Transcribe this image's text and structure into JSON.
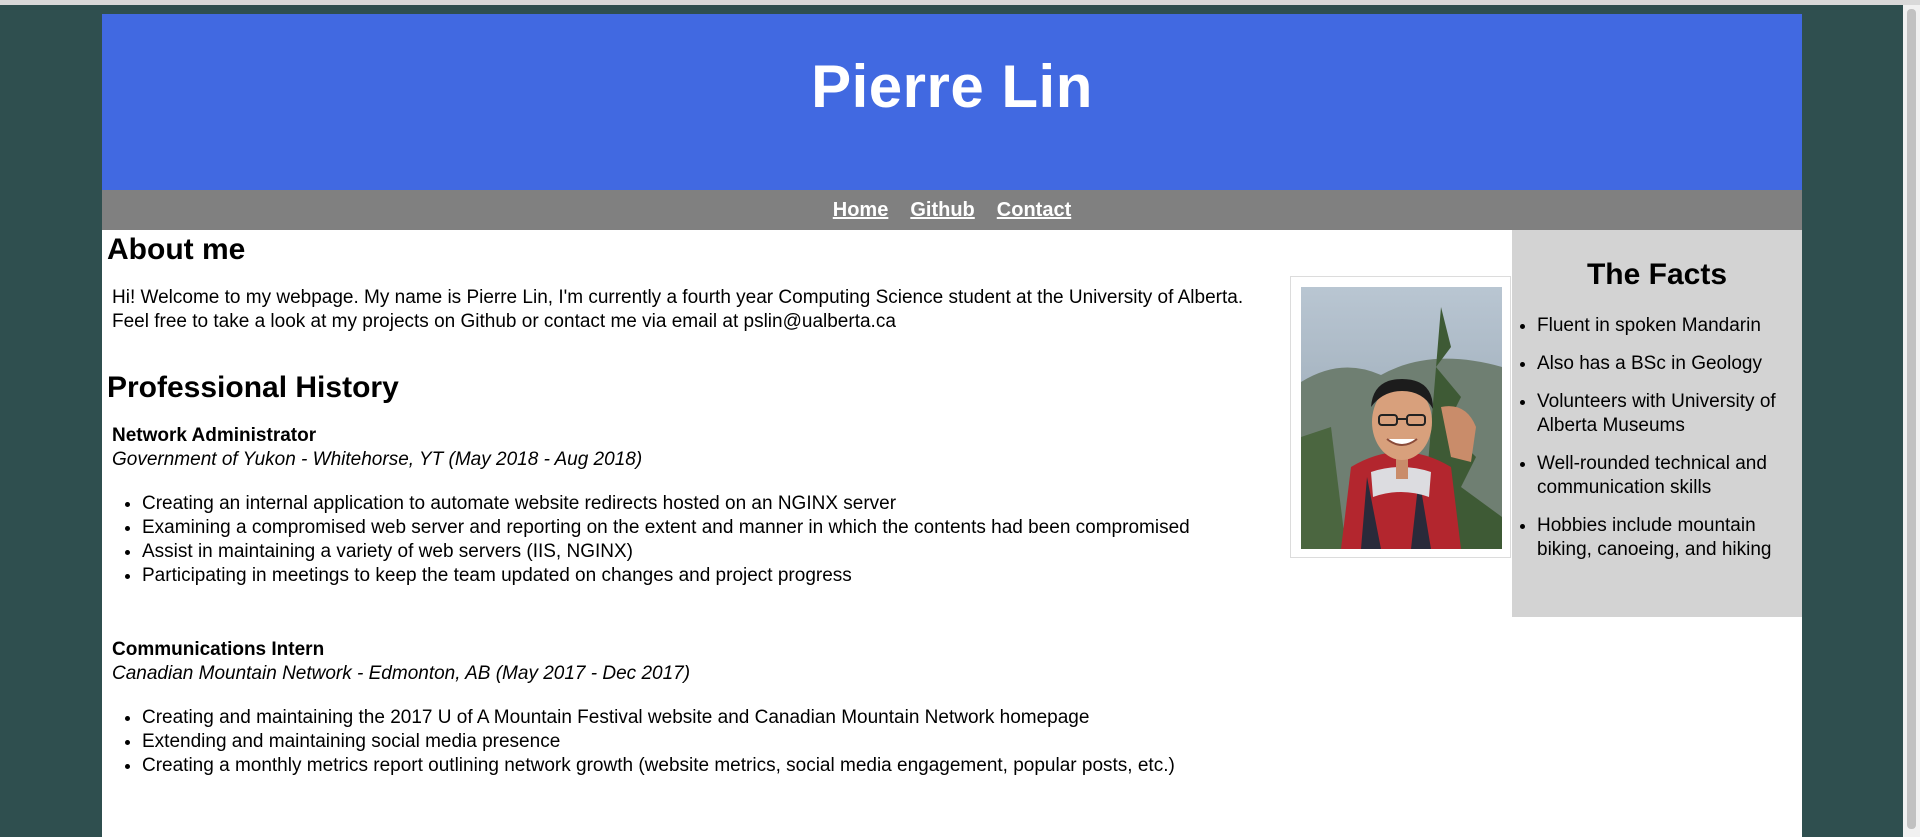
{
  "header": {
    "title": "Pierre Lin"
  },
  "nav": {
    "items": [
      "Home",
      "Github",
      "Contact"
    ]
  },
  "about": {
    "heading": "About me",
    "text": "Hi! Welcome to my webpage. My name is Pierre Lin, I'm currently a fourth year Computing Science student at the University of Alberta. Feel free to take a look at my projects on Github or contact me via email at pslin@ualberta.ca"
  },
  "professional": {
    "heading": "Professional History",
    "jobs": [
      {
        "title": "Network Administrator",
        "org": "Government of Yukon - Whitehorse, YT (May 2018 - Aug 2018)",
        "bullets": [
          "Creating an internal application to automate website redirects hosted on an NGINX server",
          "Examining a compromised web server and reporting on the extent and manner in which the contents had been compromised",
          "Assist in maintaining a variety of web servers (IIS, NGINX)",
          "Participating in meetings to keep the team updated on changes and project progress"
        ]
      },
      {
        "title": "Communications Intern",
        "org": "Canadian Mountain Network - Edmonton, AB (May 2017 - Dec 2017)",
        "bullets": [
          "Creating and maintaining the 2017 U of A Mountain Festival website and Canadian Mountain Network homepage",
          "Extending and maintaining social media presence",
          "Creating a monthly metrics report outlining network growth (website metrics, social media engagement, popular posts, etc.)"
        ]
      }
    ]
  },
  "facts": {
    "title": "The Facts",
    "items": [
      "Fluent in spoken Mandarin",
      "Also has a BSc in Geology",
      "Volunteers with University of Alberta Museums",
      "Well-rounded technical and communication skills",
      "Hobbies include mountain biking, canoeing, and hiking"
    ]
  },
  "colors": {
    "header_bg": "#4169e1",
    "nav_bg": "#808080",
    "facts_bg": "#d3d3d3",
    "page_bg": "#2f4f4f"
  }
}
